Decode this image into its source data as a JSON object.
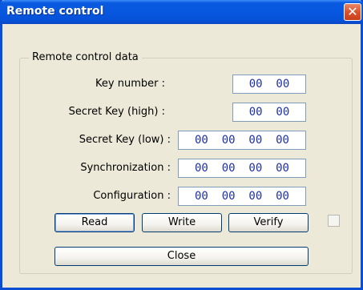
{
  "window": {
    "title": "Remote control"
  },
  "group": {
    "label": "Remote control data"
  },
  "fields": {
    "key_number": {
      "label": "Key number :",
      "value": "00  00"
    },
    "secret_high": {
      "label": "Secret Key (high) :",
      "value": "00  00"
    },
    "secret_low": {
      "label": "Secret Key (low) :",
      "value": "00  00  00  00"
    },
    "sync": {
      "label": "Synchronization :",
      "value": "00  00  00  00"
    },
    "config": {
      "label": "Configuration :",
      "value": "00  00  00  00"
    }
  },
  "buttons": {
    "read": "Read",
    "write": "Write",
    "verify": "Verify",
    "close": "Close"
  },
  "icons": {
    "close": "close-x-icon"
  },
  "colors": {
    "titlebar": "#0857e0",
    "field_text": "#1c2fa8",
    "close_button": "#d9542c"
  }
}
